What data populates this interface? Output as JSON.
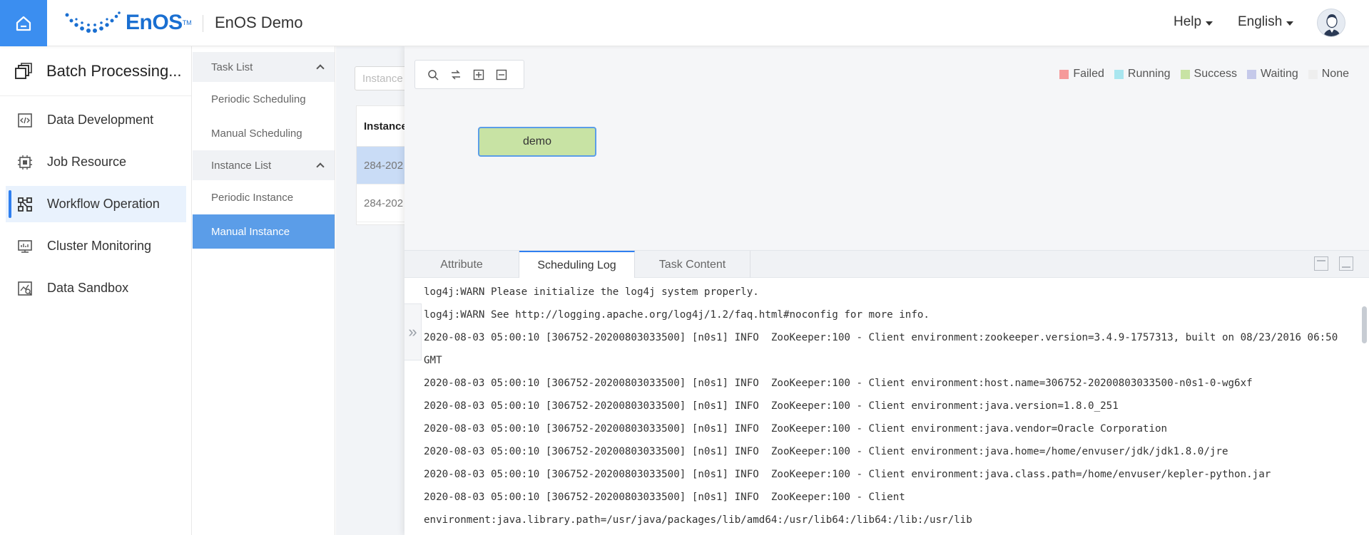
{
  "app": {
    "brand": "EnOS",
    "brand_tm": "TM",
    "title": "EnOS Demo"
  },
  "header": {
    "help": "Help",
    "language": "English"
  },
  "module": {
    "title": "Batch Processing..."
  },
  "nav": {
    "items": [
      {
        "label": "Data Development",
        "icon": "code-icon"
      },
      {
        "label": "Job Resource",
        "icon": "chip-icon"
      },
      {
        "label": "Workflow Operation",
        "icon": "workflow-icon",
        "active": true
      },
      {
        "label": "Cluster Monitoring",
        "icon": "monitor-icon"
      },
      {
        "label": "Data Sandbox",
        "icon": "sandbox-icon"
      }
    ]
  },
  "subnav": {
    "task_list": {
      "title": "Task List",
      "items": [
        "Periodic Scheduling",
        "Manual Scheduling"
      ]
    },
    "instance_list": {
      "title": "Instance List",
      "items": [
        "Periodic Instance",
        "Manual Instance"
      ]
    }
  },
  "background": {
    "search_placeholder": "Instance",
    "table_header": "Instance",
    "rows": [
      "284-202",
      "284-202"
    ]
  },
  "legend": [
    {
      "label": "Failed",
      "color": "#f59a9a"
    },
    {
      "label": "Running",
      "color": "#a9e6ef"
    },
    {
      "label": "Success",
      "color": "#c8e3a4"
    },
    {
      "label": "Waiting",
      "color": "#c5c9ea"
    },
    {
      "label": "None",
      "color": "#eeeeee"
    }
  ],
  "node": {
    "label": "demo",
    "status_color": "#c8e3a4",
    "border_color": "#5b9de8"
  },
  "tabs": [
    {
      "label": "Attribute"
    },
    {
      "label": "Scheduling Log",
      "active": true
    },
    {
      "label": "Task Content"
    }
  ],
  "log": [
    "log4j:WARN Please initialize the log4j system properly.",
    "log4j:WARN See http://logging.apache.org/log4j/1.2/faq.html#noconfig for more info.",
    "2020-08-03 05:00:10 [306752-20200803033500] [n0s1] INFO  ZooKeeper:100 - Client environment:zookeeper.version=3.4.9-1757313, built on 08/23/2016 06:50 GMT",
    "2020-08-03 05:00:10 [306752-20200803033500] [n0s1] INFO  ZooKeeper:100 - Client environment:host.name=306752-20200803033500-n0s1-0-wg6xf",
    "2020-08-03 05:00:10 [306752-20200803033500] [n0s1] INFO  ZooKeeper:100 - Client environment:java.version=1.8.0_251",
    "2020-08-03 05:00:10 [306752-20200803033500] [n0s1] INFO  ZooKeeper:100 - Client environment:java.vendor=Oracle Corporation",
    "2020-08-03 05:00:10 [306752-20200803033500] [n0s1] INFO  ZooKeeper:100 - Client environment:java.home=/home/envuser/jdk/jdk1.8.0/jre",
    "2020-08-03 05:00:10 [306752-20200803033500] [n0s1] INFO  ZooKeeper:100 - Client environment:java.class.path=/home/envuser/kepler-python.jar",
    "2020-08-03 05:00:10 [306752-20200803033500] [n0s1] INFO  ZooKeeper:100 - Client environment:java.library.path=/usr/java/packages/lib/amd64:/usr/lib64:/lib64:/lib:/usr/lib"
  ]
}
